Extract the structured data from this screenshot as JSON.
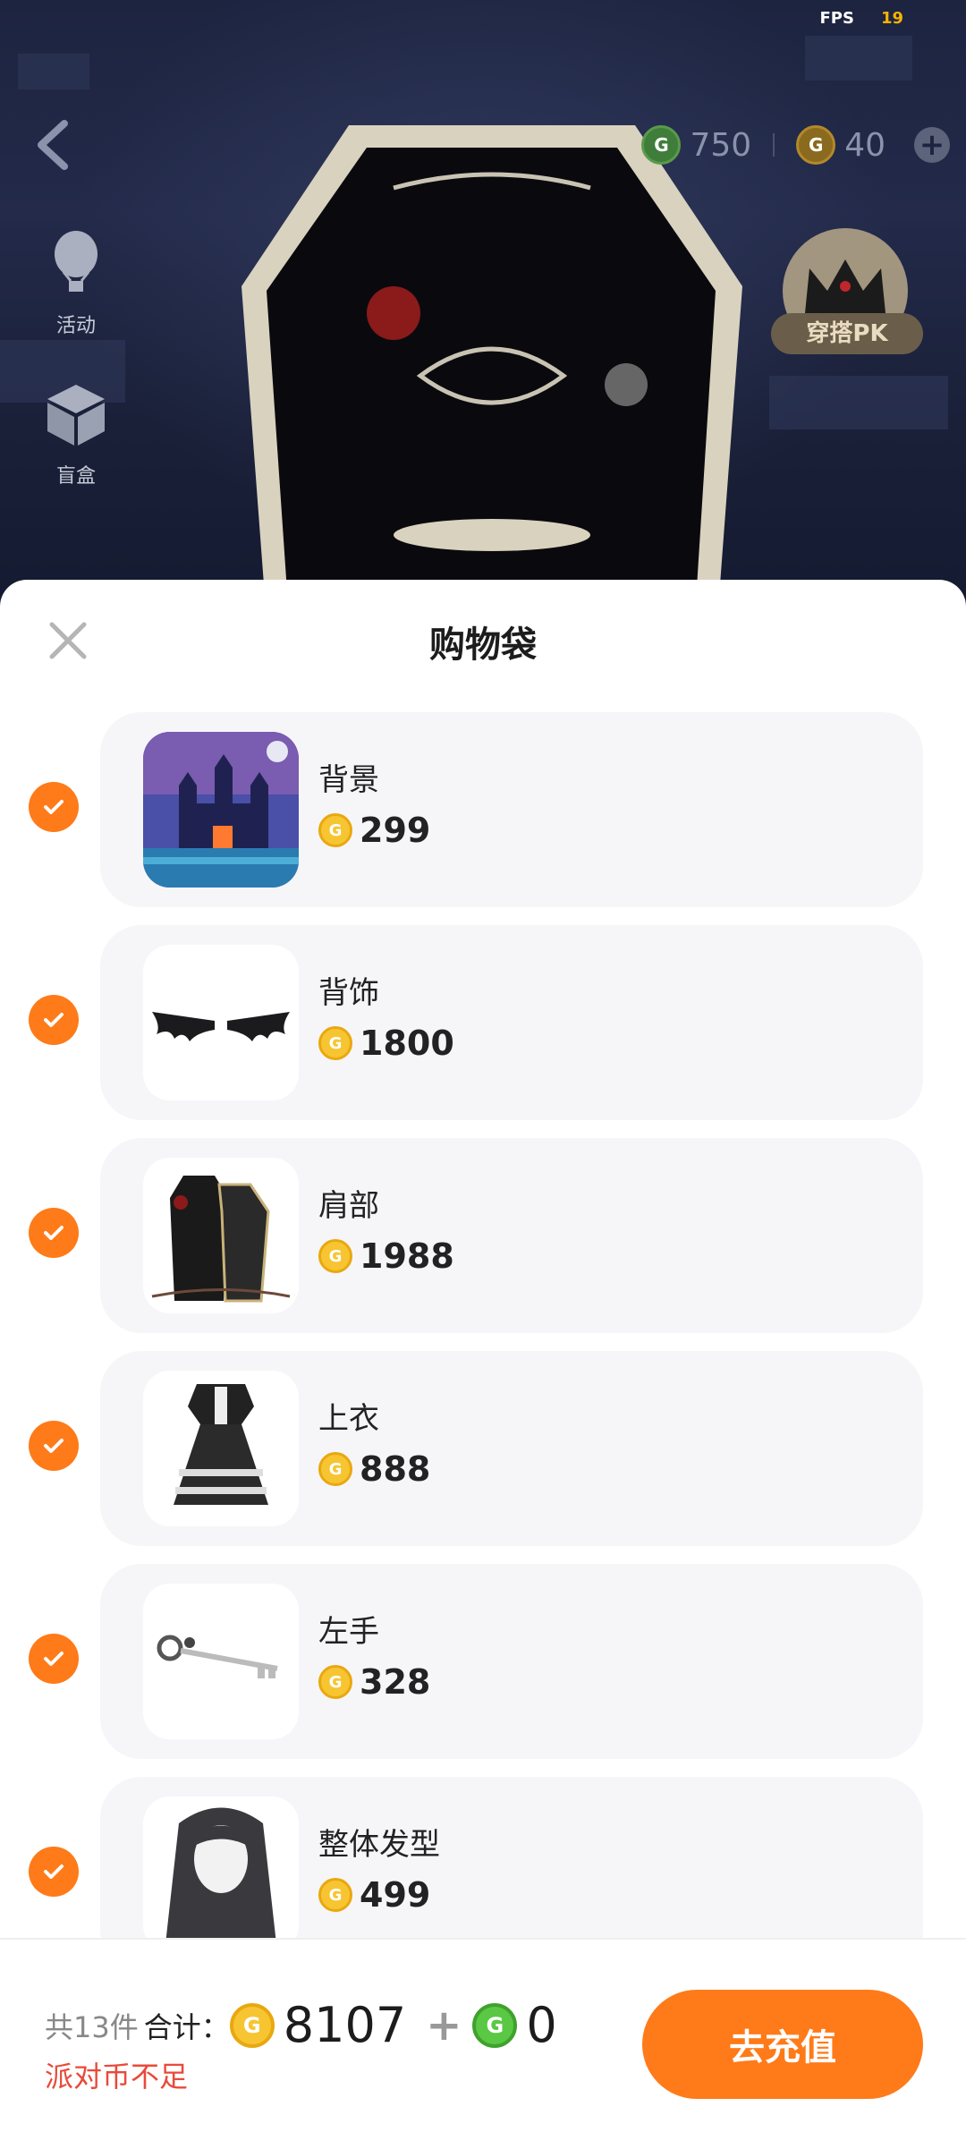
{
  "status": {
    "fps_label": "FPS",
    "fps_value": "19"
  },
  "top_bar": {
    "green_coin_amount": "750",
    "gold_coin_amount": "40"
  },
  "side_buttons": [
    {
      "label": "活动",
      "icon": "hot-air-balloon-icon"
    },
    {
      "label": "盲盒",
      "icon": "blind-box-icon"
    }
  ],
  "pk_badge": {
    "label": "穿搭PK",
    "icon": "crown-icon"
  },
  "sheet": {
    "title": "购物袋",
    "items": [
      {
        "name": "背景",
        "price": "299",
        "checked": true,
        "thumb": "castle-background"
      },
      {
        "name": "背饰",
        "price": "1800",
        "checked": true,
        "thumb": "bat-wings"
      },
      {
        "name": "肩部",
        "price": "1988",
        "checked": true,
        "thumb": "coffin"
      },
      {
        "name": "上衣",
        "price": "888",
        "checked": true,
        "thumb": "gothic-dress"
      },
      {
        "name": "左手",
        "price": "328",
        "checked": true,
        "thumb": "skeleton-key"
      },
      {
        "name": "整体发型",
        "price": "499",
        "checked": true,
        "thumb": "long-hair"
      }
    ]
  },
  "footer": {
    "count_text": "共13件",
    "sum_label": "合计：",
    "gold_total": "8107",
    "plus": "+",
    "green_total": "0",
    "warning": "派对币不足",
    "recharge_label": "去充值"
  },
  "colors": {
    "accent": "#ff7a18",
    "warning": "#e84a3a",
    "gold_coin": "#f7c531",
    "green_coin": "#5ac844"
  }
}
